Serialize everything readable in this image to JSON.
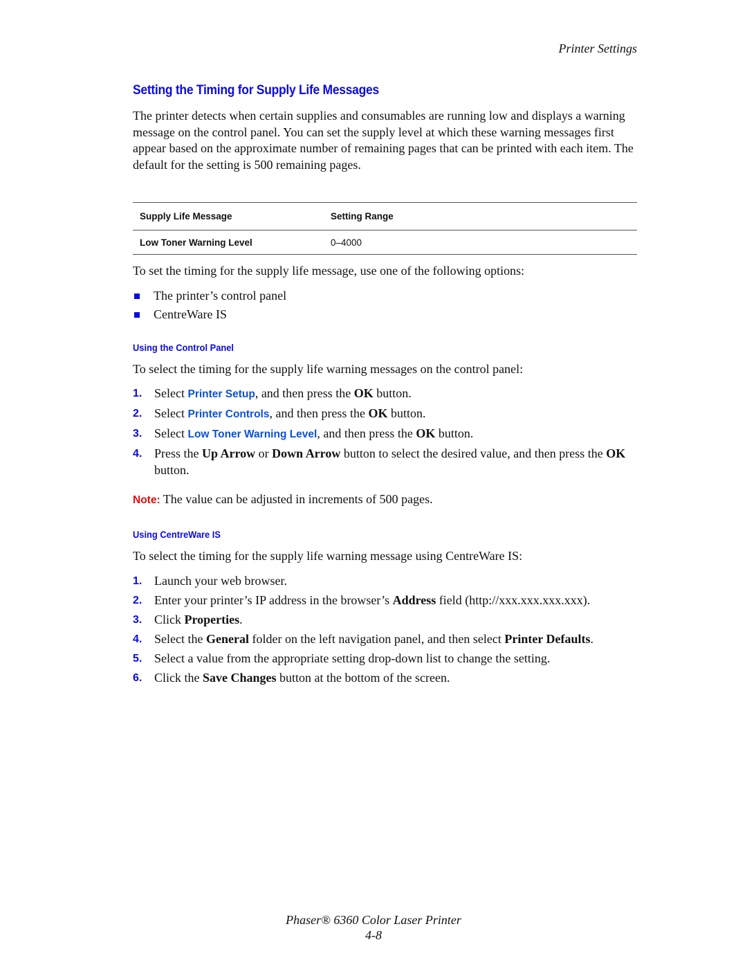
{
  "header": {
    "running_title": "Printer Settings"
  },
  "section": {
    "title": "Setting the Timing for Supply Life Messages",
    "intro": "The printer detects when certain supplies and consumables are running low and displays a warning message on the control panel. You can set the supply level at which these warning messages first appear based on the approximate number of remaining pages that can be printed with each item. The default for the setting is 500 remaining pages."
  },
  "table": {
    "headers": [
      "Supply Life Message",
      "Setting Range"
    ],
    "rows": [
      [
        "Low Toner Warning Level",
        "0–4000"
      ]
    ]
  },
  "options": {
    "intro": "To set the timing for the supply life message, use one of the following options:",
    "items": [
      "The printer’s control panel",
      "CentreWare IS"
    ]
  },
  "control_panel": {
    "heading": "Using the Control Panel",
    "intro": "To select the timing for the supply life warning messages on the control panel:",
    "steps": [
      {
        "num": "1.",
        "pre": "Select ",
        "term": "Printer Setup",
        "post": ", and then press the ",
        "bold": "OK",
        "end": " button."
      },
      {
        "num": "2.",
        "pre": "Select ",
        "term": "Printer Controls",
        "post": ", and then press the ",
        "bold": "OK",
        "end": " button."
      },
      {
        "num": "3.",
        "pre": "Select ",
        "term": "Low Toner Warning Level",
        "post": ", and then press the ",
        "bold": "OK",
        "end": " button."
      },
      {
        "num": "4.",
        "pre": "Press the ",
        "bold1": "Up Arrow",
        "mid": " or ",
        "bold2": "Down Arrow",
        "mid2": " button to select the desired value, and then press the ",
        "bold3": "OK",
        "end": " button."
      }
    ],
    "note_label": "Note:",
    "note_text": " The value can be adjusted in increments of 500 pages."
  },
  "centreware": {
    "heading": "Using CentreWare IS",
    "intro": "To select the timing for the supply life warning message using CentreWare IS:",
    "steps": [
      {
        "num": "1.",
        "text": "Launch your web browser."
      },
      {
        "num": "2.",
        "pre": "Enter your printer’s IP address in the browser’s ",
        "bold": "Address",
        "post": " field (http://xxx.xxx.xxx.xxx)."
      },
      {
        "num": "3.",
        "pre": "Click ",
        "bold": "Properties",
        "post": "."
      },
      {
        "num": "4.",
        "pre": "Select the ",
        "bold": "General",
        "mid": " folder on the left navigation panel, and then select ",
        "bold2": "Printer Defaults",
        "post": "."
      },
      {
        "num": "5.",
        "text": "Select a value from the appropriate setting drop-down list to change the setting."
      },
      {
        "num": "6.",
        "pre": "Click the ",
        "bold": "Save Changes",
        "post": " button at the bottom of the screen."
      }
    ]
  },
  "footer": {
    "product": "Phaser® 6360 Color Laser Printer",
    "page_number": "4-8"
  },
  "colors": {
    "heading_blue": "#0a0ae6",
    "ui_term_blue": "#0a50dc",
    "note_red": "#e60a0a",
    "rule_gray": "#555555"
  }
}
